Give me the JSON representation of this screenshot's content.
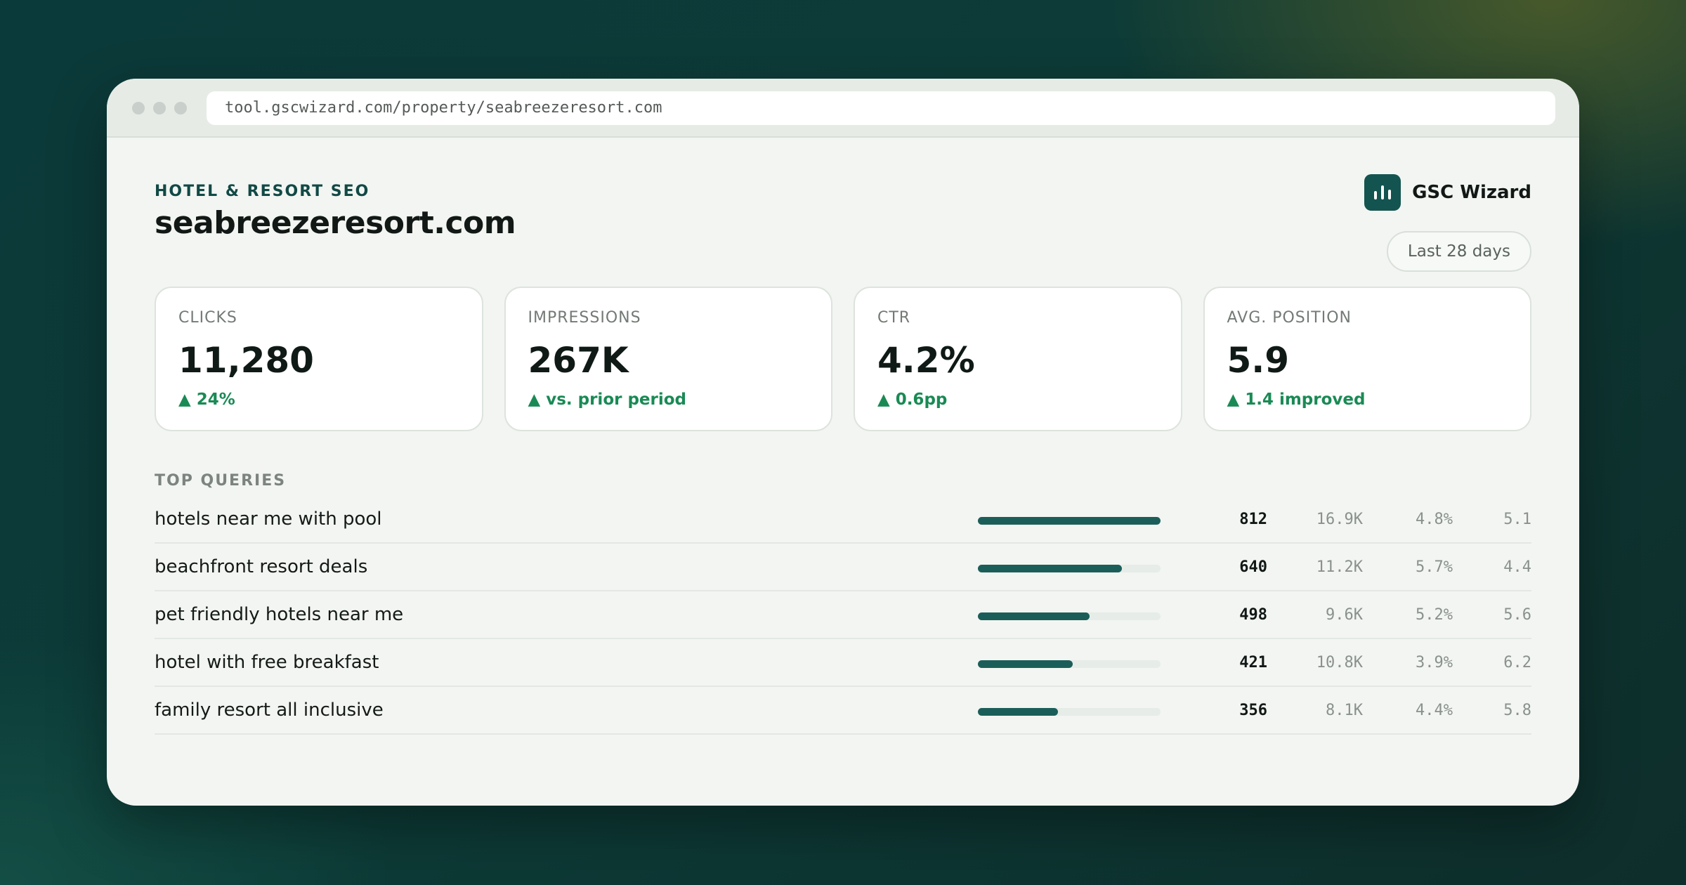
{
  "browser": {
    "url": "tool.gscwizard.com/property/seabreezeresort.com"
  },
  "header": {
    "eyebrow": "HOTEL & RESORT SEO",
    "title": "seabreezeresort.com",
    "brand_name": "GSC Wizard",
    "brand_icon": "bar-chart-icon",
    "date_range": "Last 28 days"
  },
  "metrics": [
    {
      "label": "CLICKS",
      "value": "11,280",
      "delta": "▲ 24%"
    },
    {
      "label": "IMPRESSIONS",
      "value": "267K",
      "delta": "▲ vs. prior period"
    },
    {
      "label": "CTR",
      "value": "4.2%",
      "delta": "▲ 0.6pp"
    },
    {
      "label": "AVG. POSITION",
      "value": "5.9",
      "delta": "▲ 1.4 improved"
    }
  ],
  "top_queries": {
    "title": "TOP QUERIES",
    "rows": [
      {
        "query": "hotels near me with pool",
        "bar_fraction": 1.0,
        "clicks": "812",
        "impressions": "16.9K",
        "ctr": "4.8%",
        "position": "5.1"
      },
      {
        "query": "beachfront resort deals",
        "bar_fraction": 0.79,
        "clicks": "640",
        "impressions": "11.2K",
        "ctr": "5.7%",
        "position": "4.4"
      },
      {
        "query": "pet friendly hotels near me",
        "bar_fraction": 0.61,
        "clicks": "498",
        "impressions": "9.6K",
        "ctr": "5.2%",
        "position": "5.6"
      },
      {
        "query": "hotel with free breakfast",
        "bar_fraction": 0.52,
        "clicks": "421",
        "impressions": "10.8K",
        "ctr": "3.9%",
        "position": "6.2"
      },
      {
        "query": "family resort all inclusive",
        "bar_fraction": 0.44,
        "clicks": "356",
        "impressions": "8.1K",
        "ctr": "4.4%",
        "position": "5.8"
      }
    ]
  },
  "colors": {
    "accent": "#135450",
    "positive": "#1a8a55",
    "bar": "#1b5e59"
  }
}
